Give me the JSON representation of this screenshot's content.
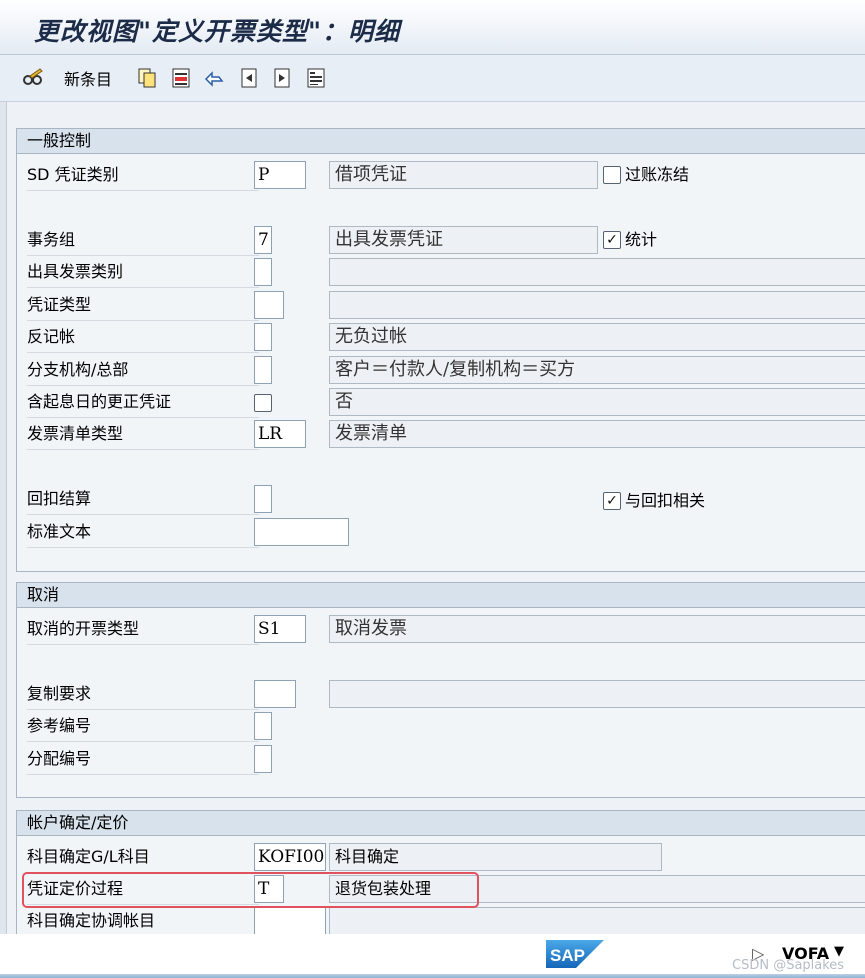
{
  "window": {
    "title": "更改视图\"定义开票类型\"：明细"
  },
  "toolbar": {
    "new_entries_label": "新条目",
    "icons": [
      "glasses-edit-icon",
      "copy-icon",
      "delete-icon",
      "undo-icon",
      "previous-entry-icon",
      "next-entry-icon",
      "transport-icon"
    ]
  },
  "sections": {
    "general": {
      "title": "一般控制",
      "sd_doc_category": {
        "label": "SD 凭证类别",
        "value": "P",
        "desc": "借项凭证"
      },
      "posting_block": {
        "label": "过账冻结",
        "checked": false
      },
      "transaction_group": {
        "label": "事务组",
        "value": "7",
        "desc": "出具发票凭证"
      },
      "statistics": {
        "label": "统计",
        "checked": true
      },
      "billing_category": {
        "label": "出具发票类别",
        "value": "",
        "desc": ""
      },
      "document_type": {
        "label": "凭证类型",
        "value": "",
        "desc": ""
      },
      "negative_posting": {
        "label": "反记帐",
        "value": "",
        "desc": "无负过帐"
      },
      "branch_head_office": {
        "label": "分支机构/总部",
        "value": "",
        "desc": "客户＝付款人/复制机构＝买方"
      },
      "credit_memo_value_date": {
        "label": "含起息日的更正凭证",
        "checked": false,
        "desc": "否"
      },
      "invoice_list_type": {
        "label": "发票清单类型",
        "value": "LR",
        "desc": "发票清单"
      },
      "rebate_settlement": {
        "label": "回扣结算",
        "value": ""
      },
      "rebate_relevant": {
        "label": "与回扣相关",
        "checked": true
      },
      "standard_text": {
        "label": "标准文本",
        "value": ""
      }
    },
    "cancellation": {
      "title": "取消",
      "cancel_billing_type": {
        "label": "取消的开票类型",
        "value": "S1",
        "desc": "取消发票"
      },
      "copy_requirements": {
        "label": "复制要求",
        "value": "",
        "desc": ""
      },
      "reference_number": {
        "label": "参考编号",
        "value": ""
      },
      "allocation_number": {
        "label": "分配编号",
        "value": ""
      }
    },
    "account_pricing": {
      "title": "帐户确定/定价",
      "acct_det_procedure": {
        "label": "科目确定G/L科目",
        "value": "KOFI00",
        "desc": "科目确定"
      },
      "doc_pricing_procedure": {
        "label": "凭证定价过程",
        "value": "T",
        "desc": "退货包装处理"
      },
      "acct_det_reconciliation": {
        "label": "科目确定协调帐目",
        "value": ""
      }
    }
  },
  "statusbar": {
    "logo_text": "SAP",
    "system": "VOFA",
    "watermark": "CSDN @Saplakes"
  },
  "colors": {
    "highlight": "#e0535e",
    "title": "#1b2b48"
  }
}
